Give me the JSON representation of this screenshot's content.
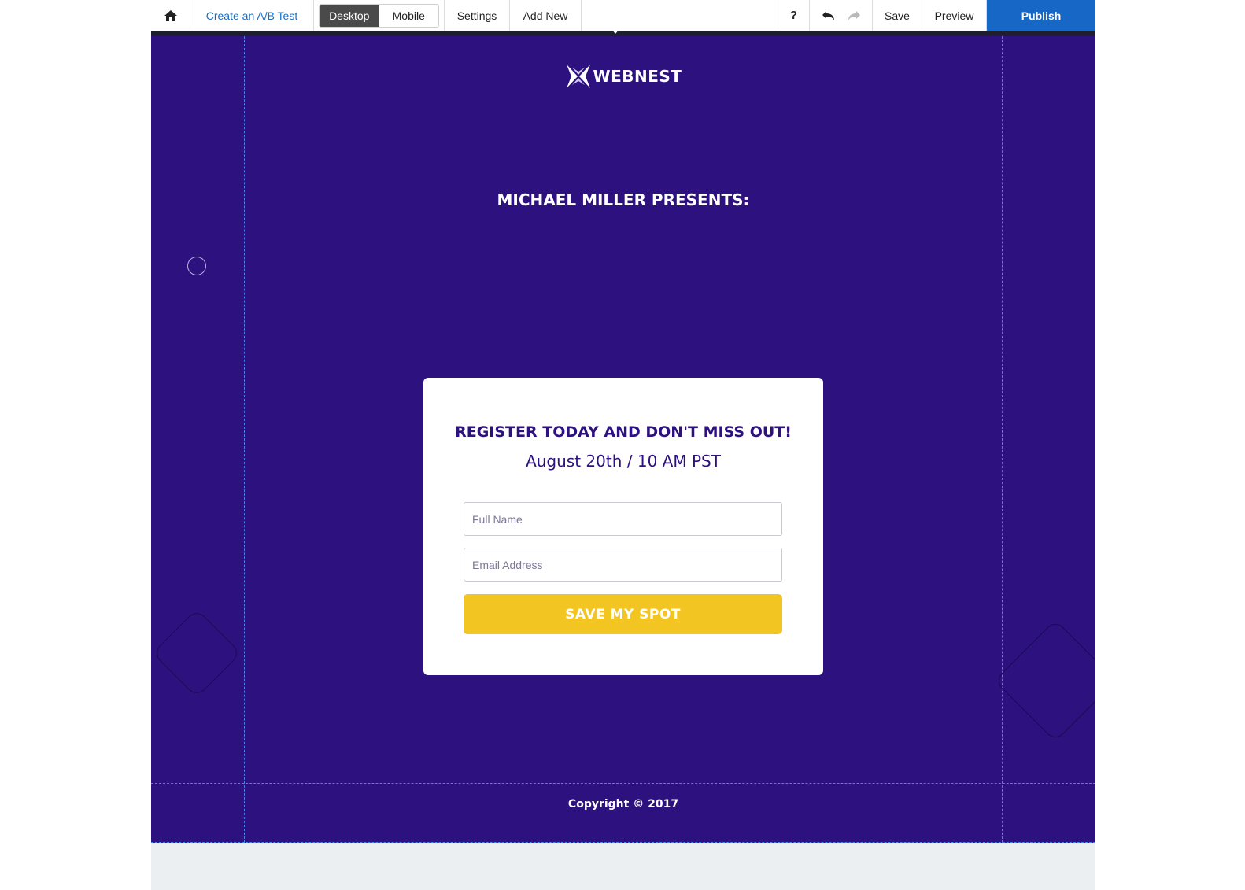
{
  "toolbar": {
    "home_icon": "home-icon",
    "ab_test_label": "Create an A/B Test",
    "view_toggle": {
      "desktop_label": "Desktop",
      "mobile_label": "Mobile",
      "selected": "Desktop"
    },
    "settings_label": "Settings",
    "add_new_label": "Add New",
    "help_label": "?",
    "undo_icon": "undo-icon",
    "redo_icon": "redo-icon",
    "save_label": "Save",
    "preview_label": "Preview",
    "publish_label": "Publish"
  },
  "page": {
    "logo_text": "WEBNEST",
    "presenter": "MICHAEL MILLER PRESENTS:",
    "form": {
      "title": "REGISTER TODAY AND DON'T MISS OUT!",
      "subtitle": "August 20th / 10 AM PST",
      "name_placeholder": "Full Name",
      "email_placeholder": "Email Address",
      "submit_label": "SAVE MY SPOT"
    },
    "copyright": "Copyright © 2017"
  },
  "colors": {
    "background": "#2d117e",
    "accent_button": "#f2c522",
    "publish": "#1767c7",
    "link": "#1a6fc6"
  }
}
